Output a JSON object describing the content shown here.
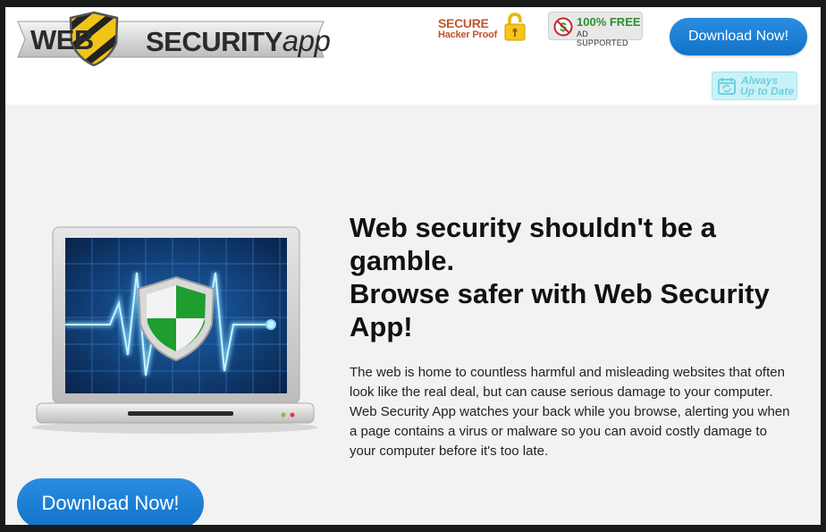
{
  "header": {
    "logo": {
      "word1": "WEB",
      "word2": "SECURITY",
      "word3": "app"
    },
    "badge_secure": {
      "line1": "SECURE",
      "line2": "Hacker Proof",
      "icon": "padlock-icon"
    },
    "badge_free": {
      "line1": "100% FREE",
      "line2": "AD SUPPORTED",
      "icon": "no-dollar-icon"
    },
    "download_label": "Download Now!",
    "badge_uptodate": {
      "line1": "Always",
      "line2": "Up to Date",
      "icon": "calendar-refresh-icon"
    }
  },
  "main": {
    "headline_line1": "Web security shouldn't be a gamble.",
    "headline_line2": "Browse safer with Web Security App!",
    "body": "The web is home to countless harmful and misleading websites that often look like the real deal, but can cause serious damage to your computer. Web Security App watches your back while you browse, alerting you when a page contains a virus or malware so you can avoid costly damage to your computer before it's too late.",
    "illustration_icon": "laptop-shield-icon",
    "download_label": "Download Now!"
  },
  "colors": {
    "button_blue": "#1b7fd6",
    "page_bg": "#f2f2f2",
    "badge_green": "#2e8f2e",
    "badge_orange": "#c0562a"
  }
}
